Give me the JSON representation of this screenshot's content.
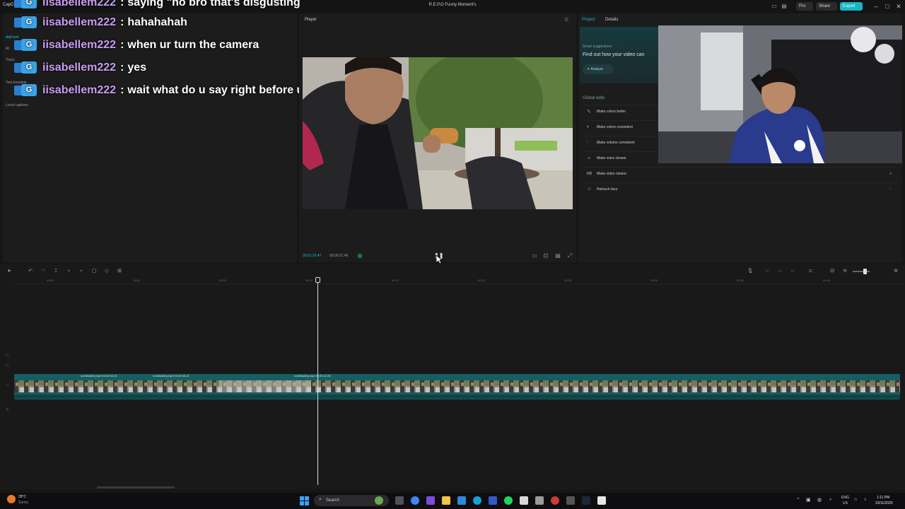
{
  "window": {
    "title": "R.E.P.O Funny Moment's",
    "app_name": "CapCut",
    "pro_label": "Pro",
    "share_label": "Share",
    "export_label": "Export"
  },
  "chat": {
    "messages": [
      {
        "user": "iisabellem222",
        "text": "saying \"no bro that's disgusting"
      },
      {
        "user": "iisabellem222",
        "text": "hahahahah"
      },
      {
        "user": "iisabellem222",
        "text": "when ur turn the camera"
      },
      {
        "user": "iisabellem222",
        "text": "yes"
      },
      {
        "user": "iisabellem222",
        "text": "wait what do u say right before u turn the cam"
      }
    ],
    "badge_label": "G"
  },
  "left_panel": {
    "items": [
      "Add text",
      "AI",
      "Yours",
      "Text template",
      "Local captions"
    ]
  },
  "player": {
    "title": "Player",
    "time_current": "00:01:16:47",
    "time_total": "00:09:21:46"
  },
  "right_panel": {
    "tabs": [
      "Project",
      "Details"
    ],
    "smart_suggestions": "Smart suggestions",
    "smart_description": "Find out how your video can",
    "analyze_label": "Analyze",
    "global_edits_title": "Global edits",
    "global_edits": [
      {
        "label": "Make colors better",
        "icon": "wand-icon"
      },
      {
        "label": "Make colors consistent",
        "icon": "color-icon"
      },
      {
        "label": "Make volume consistent",
        "icon": "volume-icon"
      },
      {
        "label": "Make voice clearer",
        "icon": "voice-icon"
      },
      {
        "label": "Make video clearer",
        "icon": "hd-icon"
      },
      {
        "label": "Retouch face",
        "icon": "face-icon"
      }
    ]
  },
  "timeline": {
    "ruler_labels": [
      "00:00",
      "10:00",
      "00:02",
      "00:03",
      "00:13",
      "00:20",
      "00:25",
      "00:30",
      "00:35",
      "00:40"
    ],
    "clip_labels": [
      "ndufhkaldhj.mp4  00:00:04:16",
      "ndufhkaldhj.mp4  00:00:06:16",
      "ndufhkaldhj.mp4  00:00:12:26"
    ]
  },
  "taskbar": {
    "weather_temp": "28°C",
    "weather_desc": "Sunny",
    "search_placeholder": "Search",
    "lang_line1": "ENG",
    "lang_line2": "US",
    "clock_time": "1:11 PM",
    "clock_date": "23/11/2025"
  },
  "colors": {
    "accent": "#18b6c4",
    "chat_username": "#c89cf2",
    "track": "#155e62"
  }
}
